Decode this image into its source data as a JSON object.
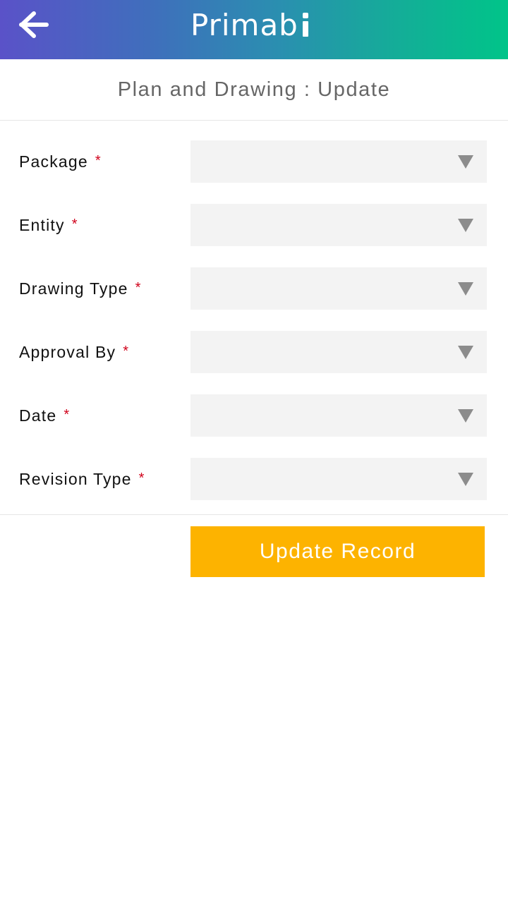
{
  "header": {
    "brand_text": "Primab",
    "brand_logo_text": "i",
    "back_icon": "arrow-left-icon"
  },
  "page": {
    "title": "Plan and Drawing : Update"
  },
  "form": {
    "required_marker": "*",
    "fields": [
      {
        "label": "Package",
        "value": "",
        "icon": "triangle-down-icon"
      },
      {
        "label": "Entity",
        "value": "",
        "icon": "triangle-down-icon"
      },
      {
        "label": "Drawing Type",
        "value": "",
        "icon": "triangle-down-icon"
      },
      {
        "label": "Approval By",
        "value": "",
        "icon": "triangle-down-icon"
      },
      {
        "label": "Date",
        "value": "",
        "icon": "triangle-down-icon"
      },
      {
        "label": "Revision Type",
        "value": "",
        "icon": "triangle-down-icon"
      }
    ],
    "submit_label": "Update Record"
  },
  "colors": {
    "header_gradient_start": "#5a52c8",
    "header_gradient_end": "#00c489",
    "required": "#d0021b",
    "select_bg": "#f3f3f3",
    "button_bg": "#fdb300"
  }
}
